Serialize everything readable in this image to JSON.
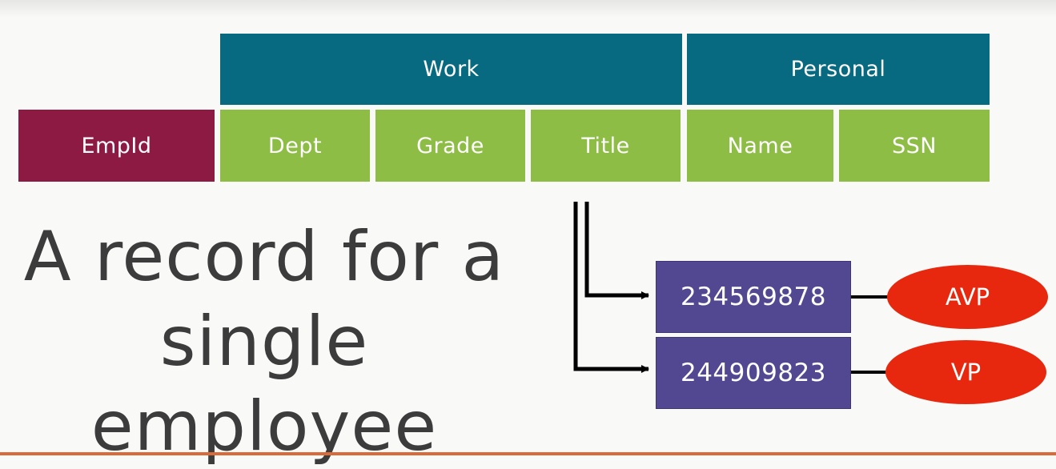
{
  "groups": {
    "work": "Work",
    "personal": "Personal"
  },
  "key_column": "EmpId",
  "columns": {
    "dept": "Dept",
    "grade": "Grade",
    "title": "Title",
    "name": "Name",
    "ssn": "SSN"
  },
  "headline": "A record for a single employee",
  "title_versions": [
    {
      "timestamp": "234569878",
      "value": "AVP"
    },
    {
      "timestamp": "244909823",
      "value": "VP"
    }
  ],
  "colors": {
    "group_header": "#086a80",
    "column": "#8dbd45",
    "key": "#8c1a43",
    "version_box": "#524892",
    "value_oval": "#e8280e"
  }
}
